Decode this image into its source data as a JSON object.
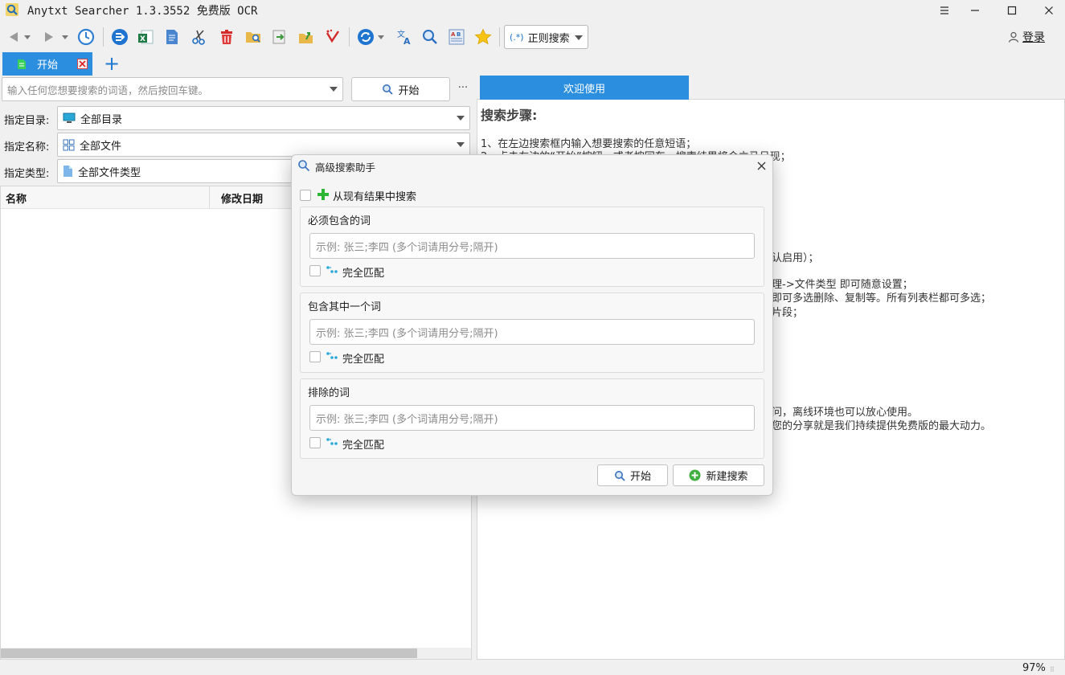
{
  "window": {
    "title": "Anytxt Searcher 1.3.3552 免费版 OCR",
    "minimize": "—",
    "maximize": "☐",
    "close": "✕"
  },
  "toolbar": {
    "regex_label": "正则搜索",
    "login_label": "登录",
    "icons": [
      "back-arrow-icon",
      "dropdown-icon",
      "forward-arrow-icon",
      "dropdown-icon",
      "history-clock-icon",
      "export-icon",
      "excel-icon",
      "document-icon",
      "scissors-icon",
      "trash-icon",
      "folder-search-icon",
      "export-page-icon",
      "open-folder-icon",
      "clean-icon",
      "refresh-icon",
      "translate-icon",
      "zoom-search-icon",
      "text-layout-icon",
      "star-icon"
    ]
  },
  "tabs": {
    "start_label": "开始",
    "add_label": "+"
  },
  "search": {
    "placeholder": "输入任何您想要搜索的词语，然后按回车键。",
    "button_label": "开始",
    "more_label": "···"
  },
  "filters": {
    "directory_label": "指定目录:",
    "directory_value": "全部目录",
    "name_label": "指定名称:",
    "name_value": "全部文件",
    "type_label": "指定类型:",
    "type_value": "全部文件类型"
  },
  "list": {
    "columns": [
      "名称",
      "修改日期"
    ]
  },
  "welcome": {
    "tab_label": "欢迎使用",
    "title": "搜索步骤:",
    "lines": [
      "1、在左边搜索框内输入想要搜索的任意短语；",
      "2、点击左边的“开始”按钮，或者按回车，搜索结果将会立马呈现；",
      "认启用）；",
      "理->文件类型 即可随意设置；",
      "即可多选删除、复制等。所有列表栏都可多选；",
      "片段；",
      "问，离线环境也可以放心使用。",
      "您的分享就是我们持续提供免费版的最大动力。"
    ]
  },
  "status": {
    "zoom": "97%"
  },
  "dialog": {
    "title": "高级搜索助手",
    "from_results_label": "从现有结果中搜索",
    "groups": [
      {
        "title": "必须包含的词",
        "placeholder": "示例: 张三;李四 (多个词请用分号;隔开)",
        "exact_label": "完全匹配"
      },
      {
        "title": "包含其中一个词",
        "placeholder": "示例: 张三;李四 (多个词请用分号;隔开)",
        "exact_label": "完全匹配"
      },
      {
        "title": "排除的词",
        "placeholder": "示例: 张三;李四 (多个词请用分号;隔开)",
        "exact_label": "完全匹配"
      }
    ],
    "start_label": "开始",
    "new_search_label": "新建搜索"
  },
  "colors": {
    "accent": "#2b8ede",
    "panel_bg": "#f0f0f0",
    "green": "#2db536"
  }
}
